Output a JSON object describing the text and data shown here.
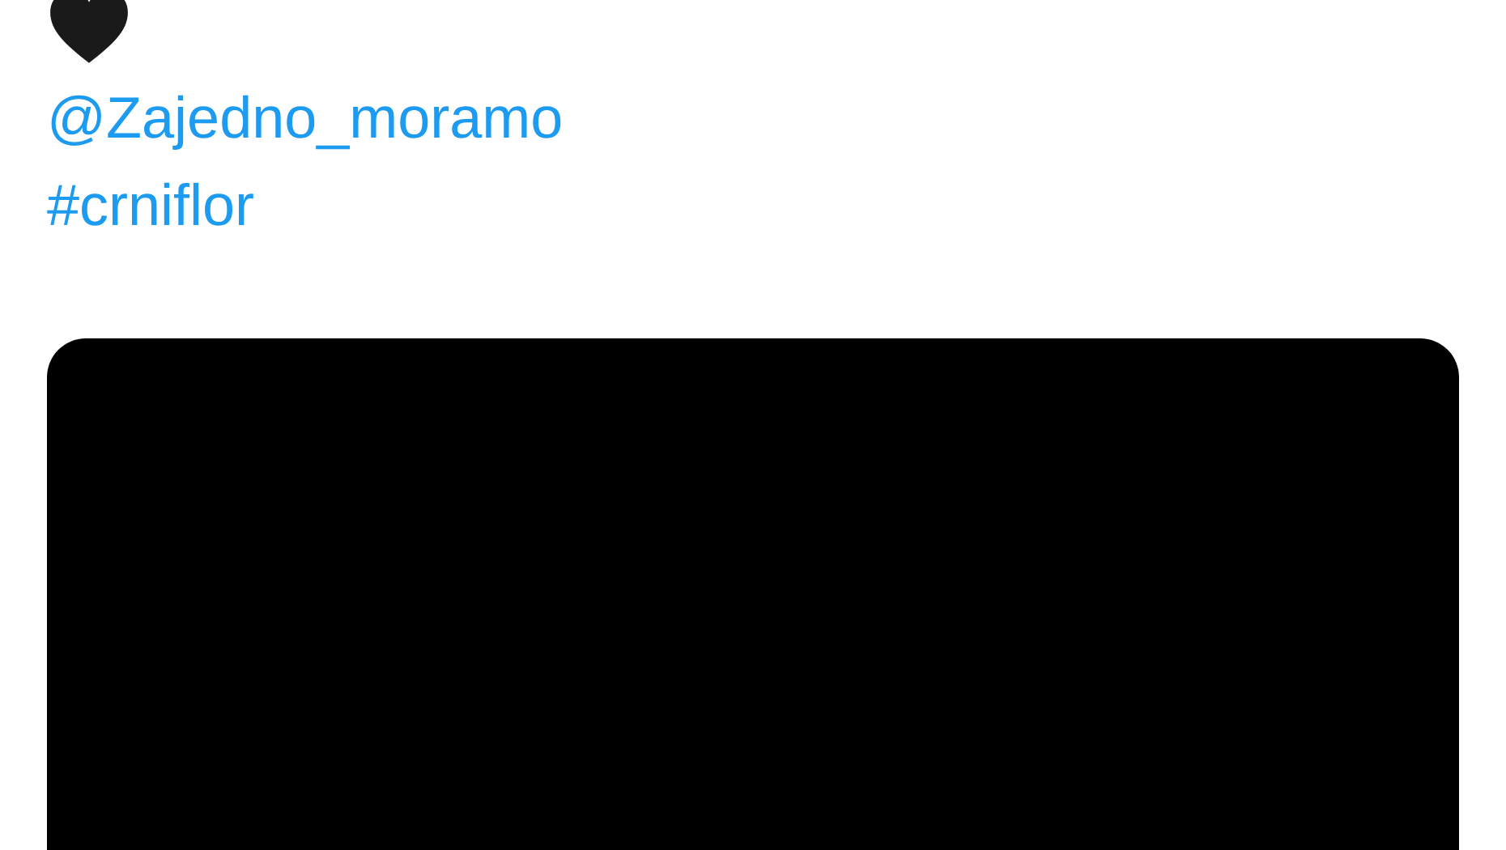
{
  "tweet": {
    "mention": "@Zajedno_moramo",
    "hashtag": "#crniflor"
  }
}
